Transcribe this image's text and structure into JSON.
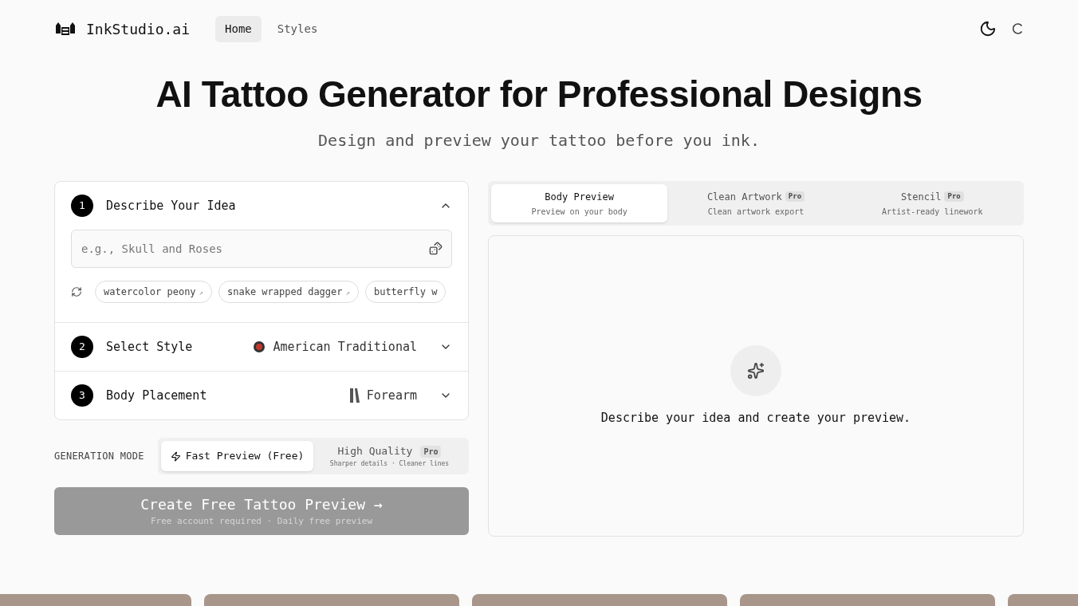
{
  "nav": {
    "brand": "InkStudio.ai",
    "links": [
      {
        "label": "Home",
        "selected": true
      },
      {
        "label": "Styles",
        "selected": false
      }
    ]
  },
  "hero": {
    "title": "AI Tattoo Generator for Professional Designs",
    "subtitle": "Design and preview your tattoo before you ink."
  },
  "steps": [
    {
      "number": "1",
      "title": "Describe Your Idea",
      "expanded": true
    },
    {
      "number": "2",
      "title": "Select Style",
      "expanded": false,
      "value": "American Traditional",
      "kind": "style"
    },
    {
      "number": "3",
      "title": "Body Placement",
      "expanded": false,
      "value": "Forearm",
      "kind": "placement"
    }
  ],
  "idea": {
    "placeholder": "e.g., Skull and Roses",
    "suggestions": [
      {
        "label": "watercolor peony",
        "arrow": "↗"
      },
      {
        "label": "snake wrapped dagger",
        "arrow": "↗"
      },
      {
        "label": "butterfly w"
      }
    ]
  },
  "generation_mode": {
    "label": "GENERATION MODE",
    "options": [
      {
        "label": "Fast Preview (Free)",
        "selected": true
      },
      {
        "label": "High Quality",
        "selected": false,
        "badge": "Pro",
        "caption": "Sharper details · Cleaner lines"
      }
    ]
  },
  "create_button": {
    "label": "Create Free Tattoo Preview →",
    "caption": "Free account required · Daily free preview",
    "disabled": true
  },
  "preview_tabs": [
    {
      "label": "Body Preview",
      "caption": "Preview on your body",
      "selected": true
    },
    {
      "label": "Clean Artwork",
      "caption": "Clean artwork export",
      "badge": "Pro",
      "selected": false
    },
    {
      "label": "Stencil",
      "caption": "Artist-ready linework",
      "badge": "Pro",
      "selected": false
    }
  ],
  "preview": {
    "message": "Describe your idea and create your preview."
  }
}
